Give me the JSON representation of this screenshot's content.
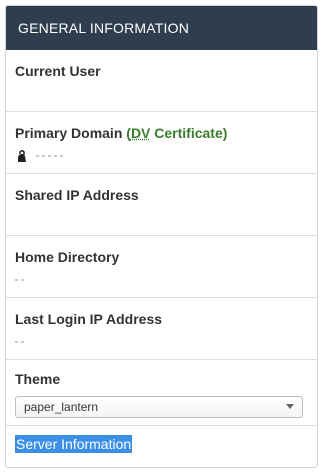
{
  "panel": {
    "title": "GENERAL INFORMATION"
  },
  "rows": {
    "current_user": {
      "label": "Current User",
      "value": ""
    },
    "primary_domain": {
      "label": "Primary Domain",
      "open_paren": "(",
      "dv": "DV",
      "cert_rest": " Certificate",
      "close_paren": ")",
      "value": "",
      "icon": "lock-icon"
    },
    "shared_ip": {
      "label": "Shared IP Address",
      "value": ""
    },
    "home_directory": {
      "label": "Home Directory",
      "value": ""
    },
    "last_login_ip": {
      "label": "Last Login IP Address",
      "value": ""
    }
  },
  "theme": {
    "label": "Theme",
    "selected": "paper_lantern",
    "icon": "chevron-down-icon"
  },
  "footer": {
    "link_label": "Server Information"
  },
  "colors": {
    "header_bg": "#2f3e4e",
    "cert_green": "#3a7d2c",
    "selection_blue": "#3b8fe5"
  }
}
